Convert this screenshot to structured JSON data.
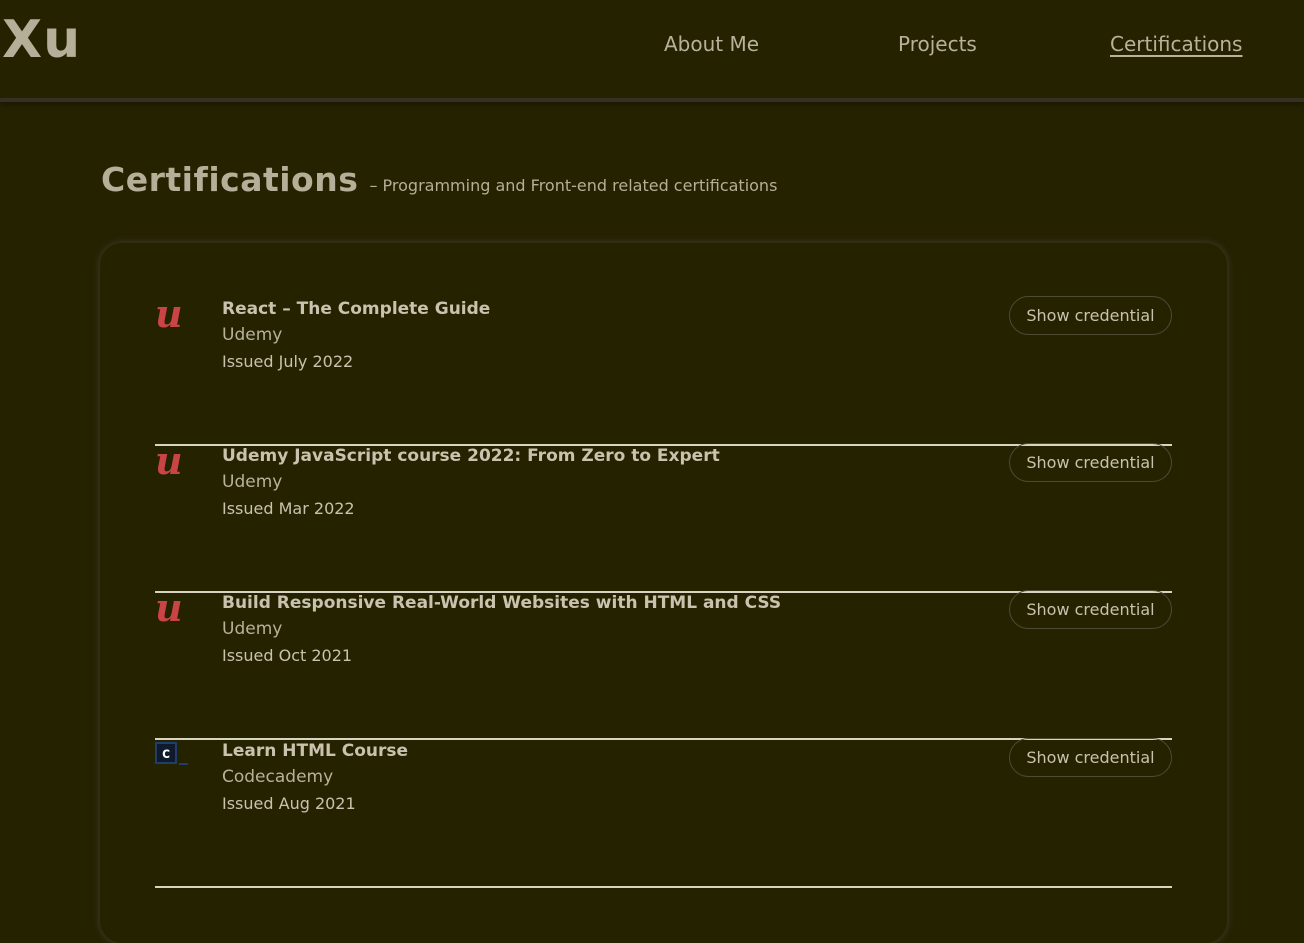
{
  "header": {
    "logo": "Xu",
    "nav": {
      "about": "About Me",
      "projects": "Projects",
      "certifications": "Certifications"
    }
  },
  "section": {
    "title": "Certifications",
    "dash": "–",
    "subtitle": "Programming and Front-end related certifications"
  },
  "certifications": [
    {
      "name": "React – The Complete Guide",
      "issuer": "Udemy",
      "issued": "Issued July 2022",
      "button": "Show credential",
      "icon": "udemy-logo-icon",
      "icon_text": "u"
    },
    {
      "name": "Udemy JavaScript course 2022: From Zero to Expert",
      "issuer": "Udemy",
      "issued": "Issued Mar 2022",
      "button": "Show credential",
      "icon": "udemy-logo-icon",
      "icon_text": "u"
    },
    {
      "name": "Build Responsive Real-World Websites with HTML and CSS",
      "issuer": "Udemy",
      "issued": "Issued Oct 2021",
      "button": "Show credential",
      "icon": "udemy-logo-icon",
      "icon_text": "u"
    },
    {
      "name": "Learn HTML Course",
      "issuer": "Codecademy",
      "issued": "Issued Aug 2021",
      "button": "Show credential",
      "icon": "codecademy-logo-icon",
      "icon_text": "c"
    }
  ],
  "colors": {
    "background": "#252200",
    "text": "#c8c2ae",
    "udemy_accent": "#c94444",
    "codecademy_accent": "#1f3f6a"
  }
}
